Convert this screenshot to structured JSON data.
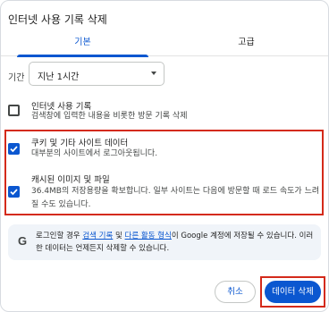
{
  "dialog": {
    "title": "인터넷 사용 기록 삭제"
  },
  "tabs": [
    {
      "label": "기본",
      "active": true
    },
    {
      "label": "고급",
      "active": false
    }
  ],
  "time_range": {
    "label": "기간",
    "value": "지난 1시간"
  },
  "items": [
    {
      "title": "인터넷 사용 기록",
      "desc": "검색창에 입력한 내용을 비롯한 방문 기록 삭제",
      "checked": false
    },
    {
      "title": "쿠키 및 기타 사이트 데이터",
      "desc": "대부분의 사이트에서 로그아웃됩니다.",
      "checked": true
    },
    {
      "title": "캐시된 이미지 및 파일",
      "desc": "36.4MB의 저장용량을 확보합니다. 일부 사이트는 다음에 방문할 때 로드 속도가 느려질 수도 있습니다.",
      "checked": true
    }
  ],
  "info": {
    "icon": "google-g-icon",
    "text_prefix": "로그인할 경우 ",
    "link1": "검색 기록",
    "text_mid": " 및 ",
    "link2": "다른 활동 형식",
    "text_suffix": "이 Google 계정에 저장될 수 있습니다. 이러한 데이터는 언제든지 삭제할 수 있습니다."
  },
  "buttons": {
    "cancel": "취소",
    "delete": "데이터 삭제"
  },
  "colors": {
    "accent": "#0b57d0",
    "highlight": "#d42a1a"
  }
}
